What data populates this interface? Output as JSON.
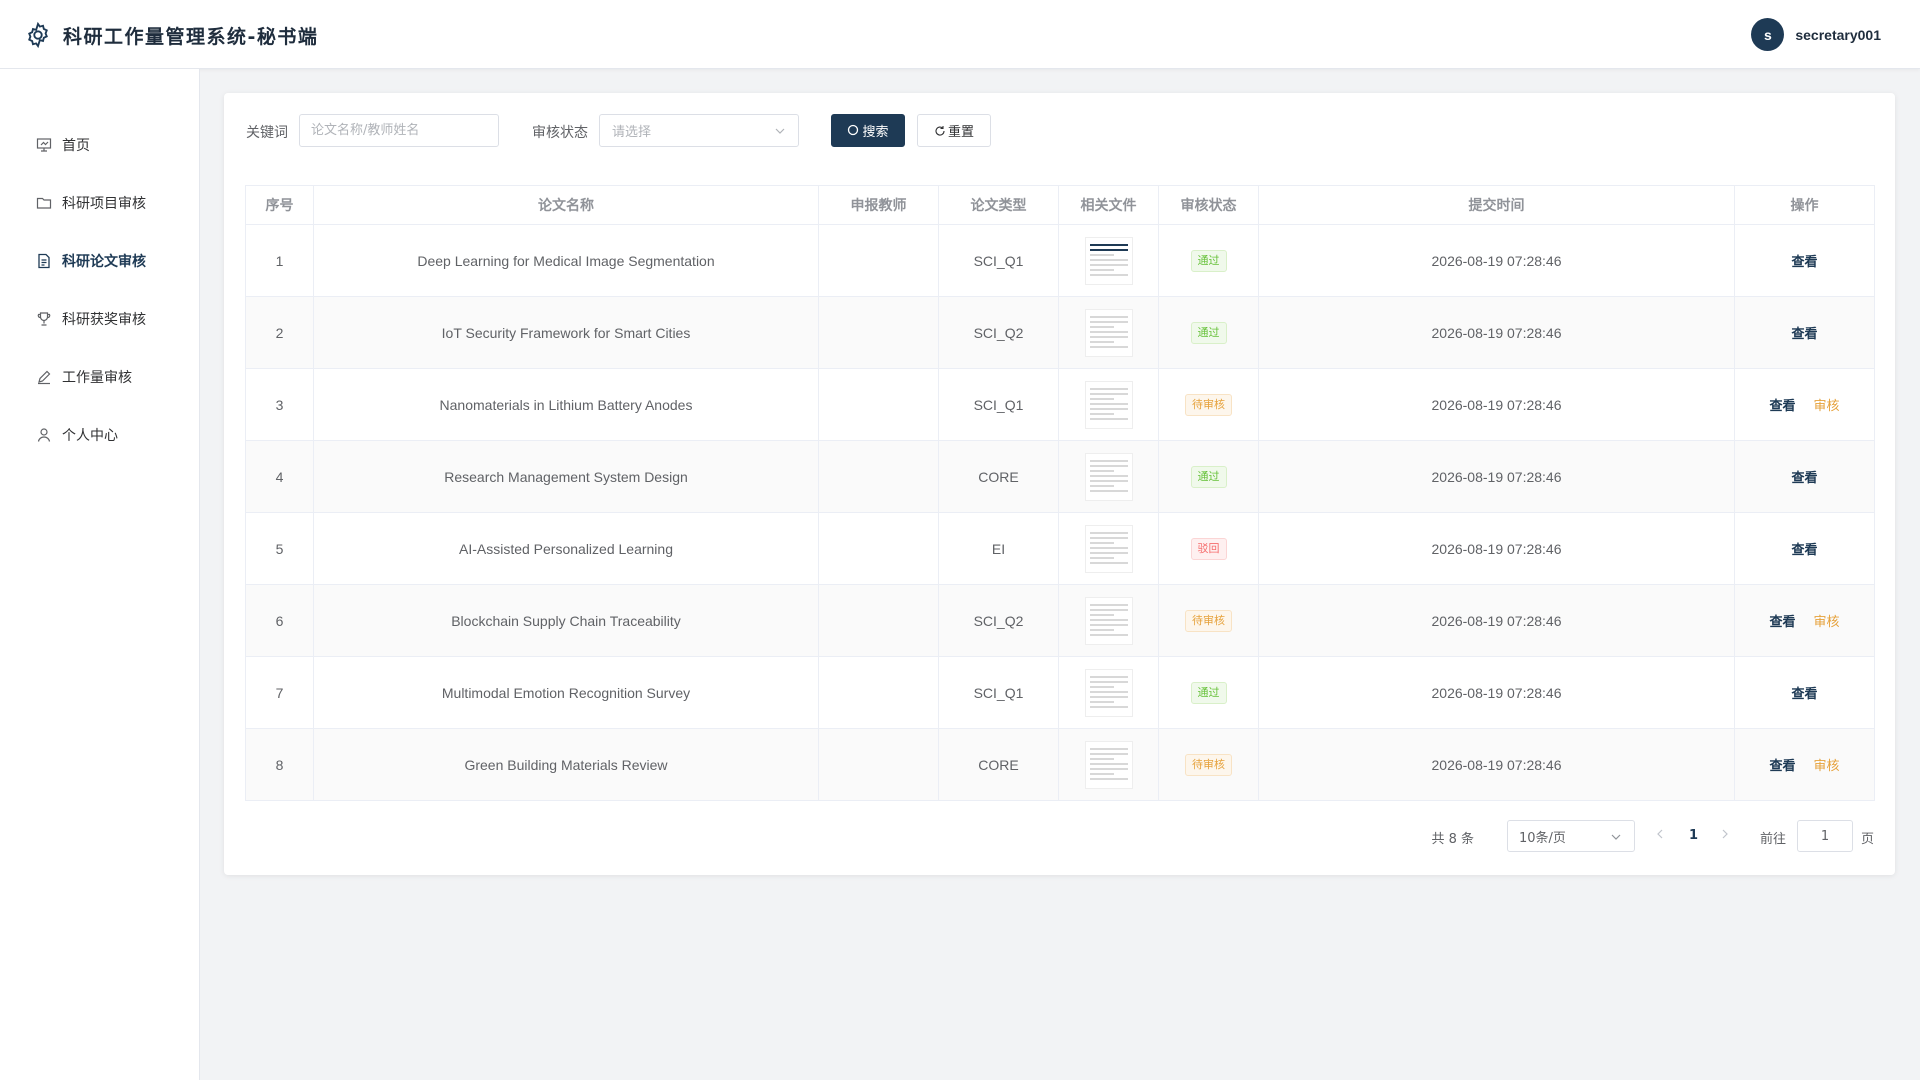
{
  "header": {
    "title": "科研工作量管理系统-秘书端",
    "user": {
      "avatar_letter": "s",
      "name": "secretary001"
    }
  },
  "sidebar": {
    "items": [
      {
        "label": "首页",
        "icon": "presentation-icon"
      },
      {
        "label": "科研项目审核",
        "icon": "folder-icon"
      },
      {
        "label": "科研论文审核",
        "icon": "document-icon",
        "active": true
      },
      {
        "label": "科研获奖审核",
        "icon": "trophy-icon"
      },
      {
        "label": "工作量审核",
        "icon": "pen-icon"
      },
      {
        "label": "个人中心",
        "icon": "user-icon"
      }
    ]
  },
  "search": {
    "keyword_label": "关键词",
    "keyword_placeholder": "论文名称/教师姓名",
    "status_label": "审核状态",
    "status_placeholder": "请选择",
    "search_button": "搜索",
    "reset_button": "重置"
  },
  "table": {
    "columns": [
      "序号",
      "论文名称",
      "申报教师",
      "论文类型",
      "相关文件",
      "审核状态",
      "提交时间",
      "操作"
    ],
    "rows": [
      {
        "index": "1",
        "name": "Deep Learning for Medical Image Segmentation",
        "teacher": "",
        "type": "SCI_Q1",
        "status": "通过",
        "status_kind": "pass",
        "time": "2026-08-19 07:28:46",
        "actions": [
          "查看"
        ]
      },
      {
        "index": "2",
        "name": "IoT Security Framework for Smart Cities",
        "teacher": "",
        "type": "SCI_Q2",
        "status": "通过",
        "status_kind": "pass",
        "time": "2026-08-19 07:28:46",
        "actions": [
          "查看"
        ]
      },
      {
        "index": "3",
        "name": "Nanomaterials in Lithium Battery Anodes",
        "teacher": "",
        "type": "SCI_Q1",
        "status": "待审核",
        "status_kind": "pending",
        "time": "2026-08-19 07:28:46",
        "actions": [
          "查看",
          "审核"
        ]
      },
      {
        "index": "4",
        "name": "Research Management System Design",
        "teacher": "",
        "type": "CORE",
        "status": "通过",
        "status_kind": "pass",
        "time": "2026-08-19 07:28:46",
        "actions": [
          "查看"
        ]
      },
      {
        "index": "5",
        "name": "AI-Assisted Personalized Learning",
        "teacher": "",
        "type": "EI",
        "status": "驳回",
        "status_kind": "reject",
        "time": "2026-08-19 07:28:46",
        "actions": [
          "查看"
        ]
      },
      {
        "index": "6",
        "name": "Blockchain Supply Chain Traceability",
        "teacher": "",
        "type": "SCI_Q2",
        "status": "待审核",
        "status_kind": "pending",
        "time": "2026-08-19 07:28:46",
        "actions": [
          "查看",
          "审核"
        ]
      },
      {
        "index": "7",
        "name": "Multimodal Emotion Recognition Survey",
        "teacher": "",
        "type": "SCI_Q1",
        "status": "通过",
        "status_kind": "pass",
        "time": "2026-08-19 07:28:46",
        "actions": [
          "查看"
        ]
      },
      {
        "index": "8",
        "name": "Green Building Materials Review",
        "teacher": "",
        "type": "CORE",
        "status": "待审核",
        "status_kind": "pending",
        "time": "2026-08-19 07:28:46",
        "actions": [
          "查看",
          "审核"
        ]
      }
    ]
  },
  "pagination": {
    "total_text": "共 8 条",
    "page_size": "10条/页",
    "current_page": "1",
    "goto_label": "前往",
    "goto_value": "1",
    "page_suffix": "页"
  },
  "colors": {
    "primary": "#1e3a55",
    "pass": "#67c23a",
    "pending": "#e6a23c",
    "reject": "#f56c6c"
  }
}
